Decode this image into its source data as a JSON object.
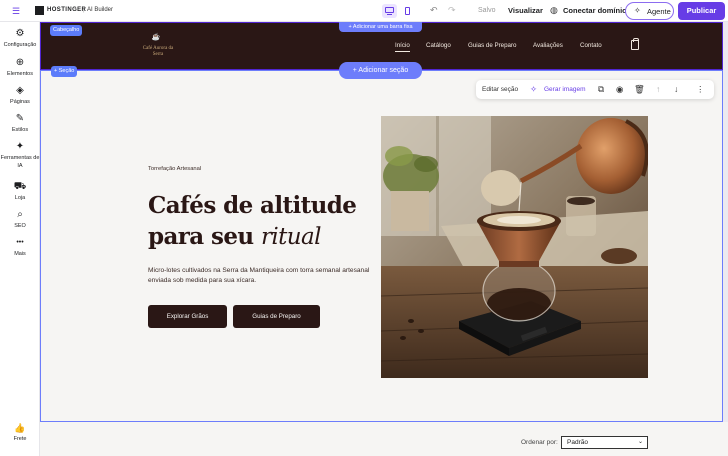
{
  "topbar": {
    "brand": "HOSTINGER",
    "separator": "|",
    "product": "AI Builder",
    "undo_icon": "↶",
    "redo_icon": "↷",
    "saved": "Salvo",
    "preview": "Visualizar",
    "connect_domain": "Conectar domínio",
    "agent": "Agente",
    "publish": "Publicar"
  },
  "sidebar": {
    "items": [
      {
        "label": "Configuração",
        "icon": "⚙"
      },
      {
        "label": "Elementos",
        "icon": "⊕"
      },
      {
        "label": "Páginas",
        "icon": "◈"
      },
      {
        "label": "Estilos",
        "icon": "✎"
      },
      {
        "label": "Ferramentas de IA",
        "icon": "✦"
      },
      {
        "label": "Loja",
        "icon": "⛟"
      },
      {
        "label": "SEO",
        "icon": "⌕"
      },
      {
        "label": "Mais",
        "icon": "•••"
      }
    ],
    "feedback": {
      "label": "Frete",
      "icon": "👍"
    }
  },
  "header": {
    "tag": "Cabeçalho",
    "add_bar": "+ Adicionar uma barra fixa",
    "logo_text": "Café Aurora da Serra",
    "nav": [
      "Início",
      "Catálogo",
      "Guias de Preparo",
      "Avaliações",
      "Contato"
    ]
  },
  "section": {
    "tag": "+ Seção",
    "add_section": "+ Adicionar seção",
    "toolbar": {
      "edit": "Editar seção",
      "generate_image": "Gerar imagem"
    }
  },
  "hero": {
    "eyebrow": "Torrefação Artesanal",
    "title_line1": "Cafés de altitude",
    "title_line2_plain": "para seu",
    "title_line2_italic": "ritual",
    "description": "Micro-lotes cultivados na Serra da Mantiqueira com torra semanal artesanal enviada sob medida para sua xícara.",
    "primary_button": "Explorar Grãos",
    "secondary_button": "Guias de Preparo"
  },
  "catalog": {
    "sort_label": "Ordenar por:",
    "sort_value": "Padrão"
  },
  "colors": {
    "accent": "#673de6",
    "header_bg": "#2a1715",
    "selection": "#6d7dfb",
    "page_bg": "#f6f5f3"
  }
}
